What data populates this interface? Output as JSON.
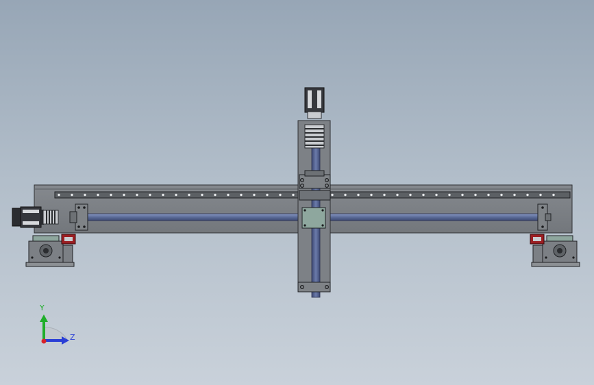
{
  "viewport": {
    "background_top": "#97a6b6",
    "background_bottom": "#c9d1da"
  },
  "triad": {
    "y_label": "Y",
    "z_label": "Z",
    "y_color": "#1fae2a",
    "z_color": "#2a3fd6",
    "x_color": "#d8232a"
  },
  "model": {
    "body_color": "#7b7f83",
    "shaft_color": "#5d6d99",
    "plate_color": "#8ea79e",
    "stop_color": "#9b1e22"
  }
}
